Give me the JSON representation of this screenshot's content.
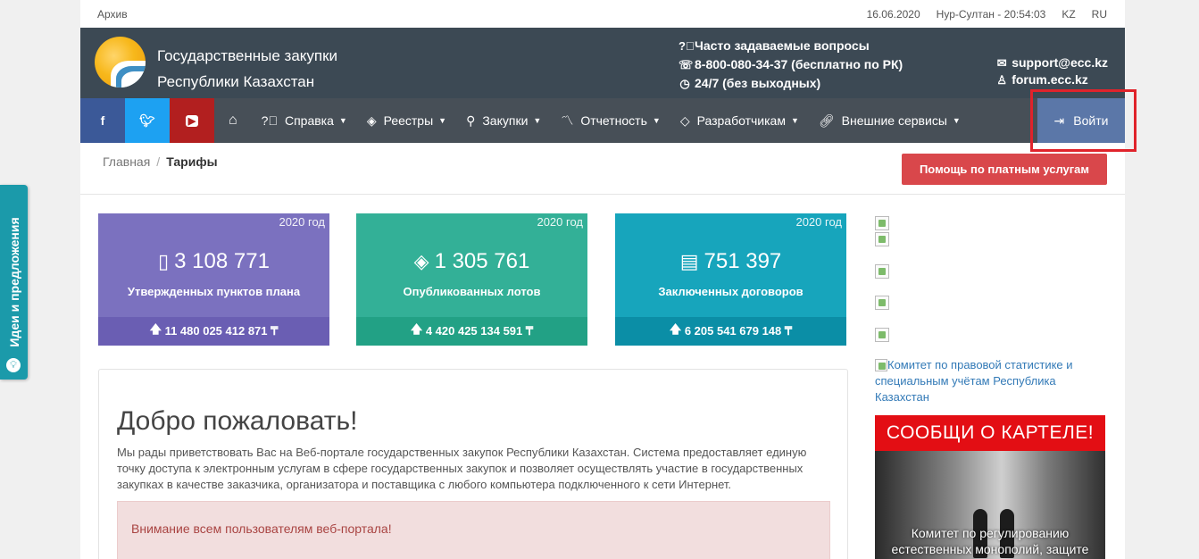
{
  "topbar": {
    "archive": "Архив",
    "date": "16.06.2020",
    "city_time": "Нур-Султан - 20:54:03",
    "lang_kz": "KZ",
    "lang_ru": "RU"
  },
  "header": {
    "title_line1": "Государственные закупки",
    "title_line2": "Республики Казахстан",
    "faq": "Часто задаваемые вопросы",
    "phone": "8-800-080-34-37 (бесплатно по РК)",
    "hours": "24/7 (без выходных)",
    "email": "support@ecc.kz",
    "forum": "forum.ecc.kz"
  },
  "nav": {
    "social": [
      "f",
      "t",
      "yt"
    ],
    "items": [
      {
        "label": "Справка",
        "icon": "question-circle-icon"
      },
      {
        "label": "Реестры",
        "icon": "layers-icon"
      },
      {
        "label": "Закупки",
        "icon": "search-icon"
      },
      {
        "label": "Отчетность",
        "icon": "chart-line-icon"
      },
      {
        "label": "Разработчикам",
        "icon": "tag-icon"
      },
      {
        "label": "Внешние сервисы",
        "icon": "link-icon"
      }
    ],
    "login": "Войти"
  },
  "breadcrumb": {
    "home": "Главная",
    "current": "Тарифы"
  },
  "help_button": "Помощь по платным услугам",
  "cards": [
    {
      "year": "2020 год",
      "value": "3 108 771",
      "label": "Утвержденных пунктов плана",
      "amount": "11 480 025 412 871 ₸"
    },
    {
      "year": "2020 год",
      "value": "1 305 761",
      "label": "Опубликованных лотов",
      "amount": "4 420 425 134 591 ₸"
    },
    {
      "year": "2020 год",
      "value": "751 397",
      "label": "Заключенных договоров",
      "amount": "6 205 541 679 148 ₸"
    }
  ],
  "welcome": {
    "title": "Добро пожаловать!",
    "text": "Мы рады приветствовать Вас на Веб-портале государственных закупок Республики Казахстан. Система предоставляет единую точку доступа к электронным услугам в сфере государственных закупок и позволяет осуществлять участие в государственных закупках в качестве заказчика, организатора и поставщика с любого компьютера подключенного к сети Интернет.",
    "alert": "Внимание всем пользователям веб-портала!"
  },
  "sidebar": {
    "committee_link": "Комитет по правовой статистике и специальным учётам Республика Казахстан",
    "cartel_title": "СООБЩИ О КАРТЕЛЕ!",
    "cartel_caption": "Комитет по регулированию естественных монополий, защите"
  },
  "ideas_tab": "Идеи и предложения",
  "colors": {
    "header_bg": "#3c4954",
    "nav_bg": "#474f57",
    "login_bg": "#5b77a8",
    "help_btn": "#d9474b",
    "card_purple": "#7b71bf",
    "card_green": "#33b097",
    "card_teal": "#17a5bc",
    "highlight": "#e0232b"
  }
}
